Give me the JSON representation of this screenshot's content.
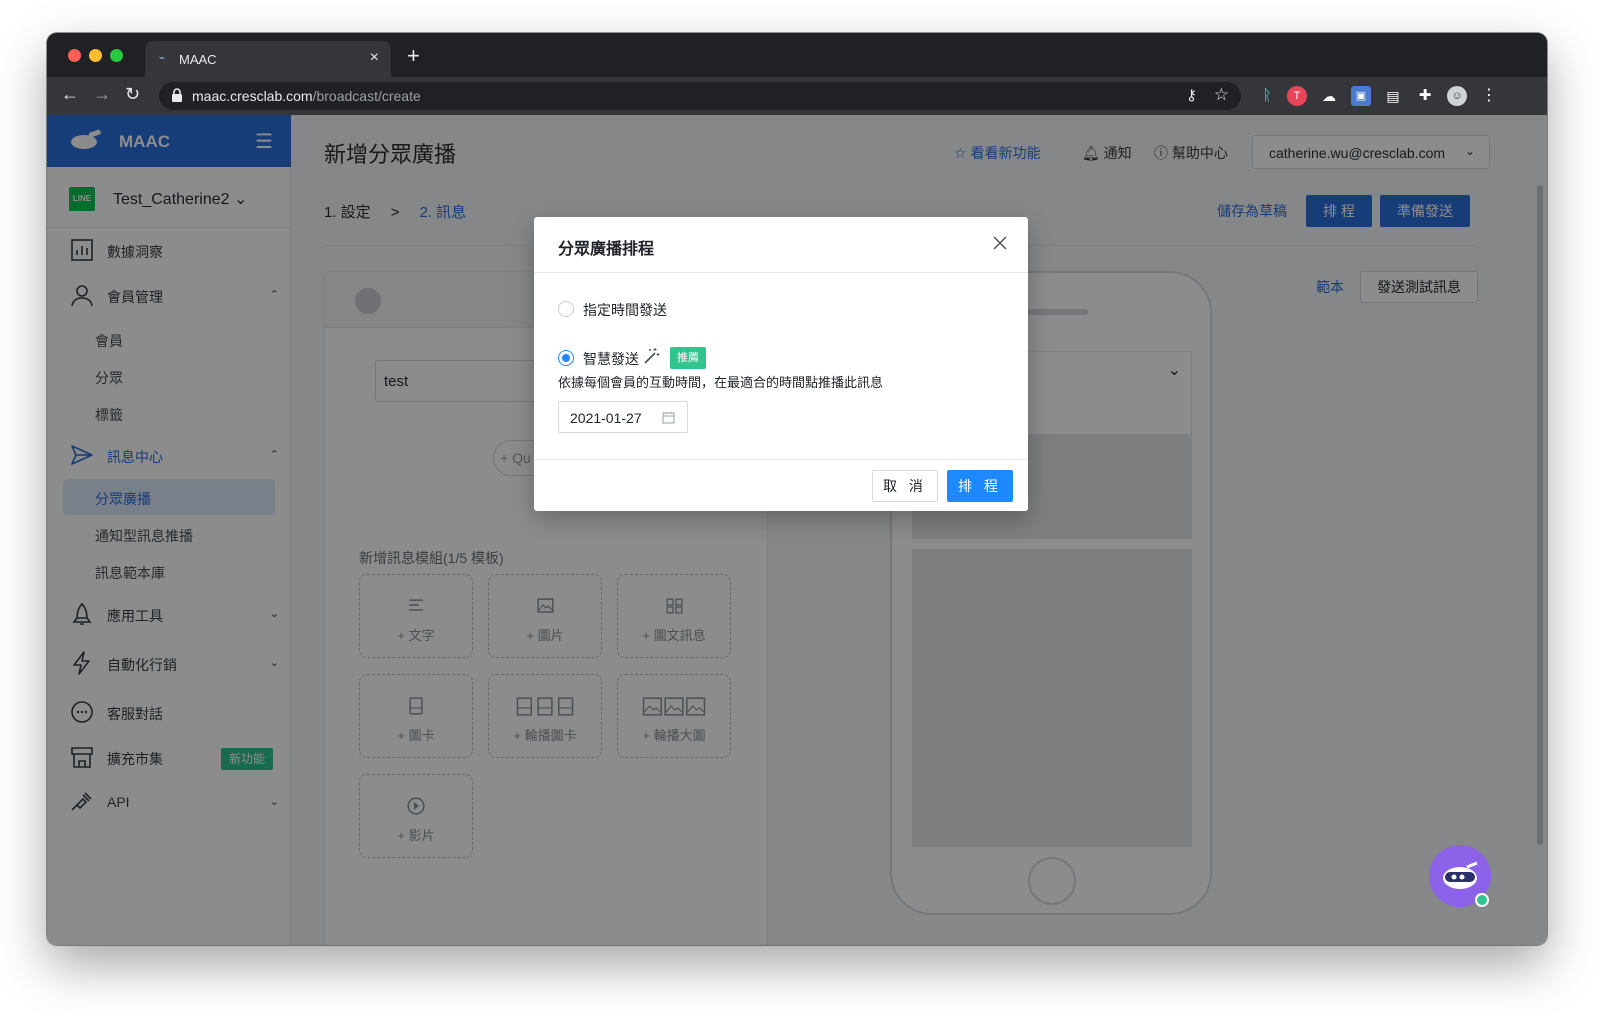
{
  "browser": {
    "tab_title": "MAAC",
    "tab_close": "×",
    "new_tab": "+",
    "url_host": "maac.cresclab.com",
    "url_path": "/broadcast/create"
  },
  "sidebar": {
    "brand": "MAAC",
    "account_badge": "LINE",
    "account_name": "Test_Catherine2",
    "items": [
      {
        "label": "數據洞察"
      },
      {
        "label": "會員管理",
        "caret": "⌃"
      },
      {
        "label": "訊息中心",
        "caret": "⌃"
      },
      {
        "label": "應用工具",
        "caret": "⌄"
      },
      {
        "label": "自動化行銷",
        "caret": "⌄"
      },
      {
        "label": "客服對話"
      },
      {
        "label": "擴充市集",
        "badge": "新功能"
      },
      {
        "label": "API",
        "caret": "⌄"
      }
    ],
    "member_sub": [
      "會員",
      "分眾",
      "標籤"
    ],
    "message_sub": [
      "分眾廣播",
      "通知型訊息推播",
      "訊息範本庫"
    ]
  },
  "header": {
    "page_title": "新增分眾廣播",
    "whats_new": "看看新功能",
    "notifications": "通知",
    "help": "幫助中心",
    "user_email": "catherine.wu@cresclab.com"
  },
  "steps": {
    "step1": "1. 設定",
    "separator": ">",
    "step2": "2. 訊息"
  },
  "actions": {
    "save_draft": "儲存為草稿",
    "schedule": "排 程",
    "prepare_send": "準備發送",
    "template": "範本",
    "send_test": "發送測試訊息"
  },
  "editor": {
    "text_value": "test",
    "quick_reply": "+ Qu",
    "modules_title": "新增訊息模組(1/5  模板)",
    "modules": [
      {
        "label": "+ 文字"
      },
      {
        "label": "+ 圖片"
      },
      {
        "label": "+ 圖文訊息"
      },
      {
        "label": "+ 圖卡"
      },
      {
        "label": "+ 輪播圖卡"
      },
      {
        "label": "+ 輪播大圖"
      },
      {
        "label": "+ 影片"
      }
    ]
  },
  "modal": {
    "title": "分眾廣播排程",
    "option_scheduled": "指定時間發送",
    "option_smart": "智慧發送",
    "recommend_badge": "推薦",
    "smart_description": "依據每個會員的互動時間，在最適合的時間點推播此訊息",
    "date_value": "2021-01-27",
    "cancel": "取 消",
    "confirm": "排 程",
    "selected_option": "smart"
  },
  "colors": {
    "primary": "#2a6fdb",
    "modal_primary": "#1e88ff",
    "success_badge": "#31c48d",
    "line_green": "#06c755",
    "chat_purple": "#8c62e8"
  }
}
